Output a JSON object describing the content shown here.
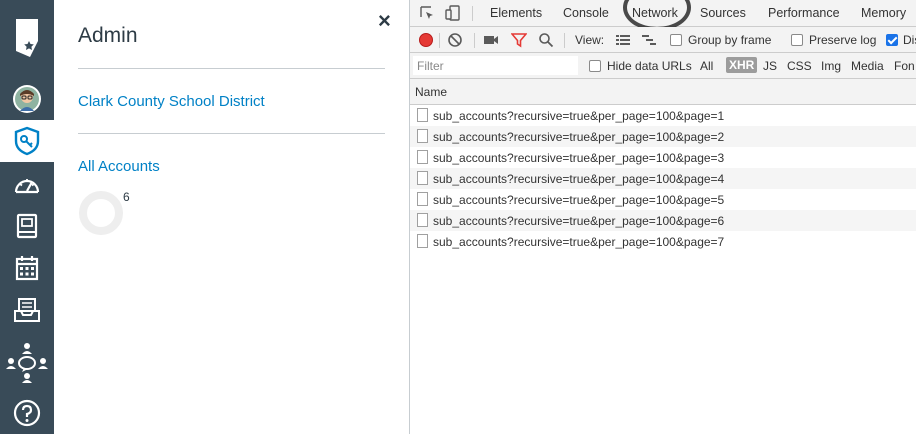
{
  "global_nav": {
    "items": [
      {
        "id": "logo",
        "icon": "nevada-state-logo-icon"
      },
      {
        "id": "account",
        "icon": "user-avatar-icon"
      },
      {
        "id": "admin",
        "icon": "admin-shield-icon",
        "active": true
      },
      {
        "id": "dashboard",
        "icon": "dashboard-speedometer-icon"
      },
      {
        "id": "courses",
        "icon": "courses-book-icon"
      },
      {
        "id": "calendar",
        "icon": "calendar-icon"
      },
      {
        "id": "inbox",
        "icon": "inbox-icon"
      },
      {
        "id": "commons",
        "icon": "commons-people-icon"
      },
      {
        "id": "help",
        "icon": "help-question-icon"
      }
    ],
    "colors": {
      "background": "#394b58",
      "active_background": "#ffffff",
      "active_icon": "#0081c6"
    }
  },
  "admin_tray": {
    "close_label": "×",
    "title": "Admin",
    "links": [
      "Clark County School District",
      "All Accounts"
    ],
    "spinner_count": "6",
    "link_color": "#0081c6"
  },
  "devtools": {
    "tabs": [
      "Elements",
      "Console",
      "Network",
      "Sources",
      "Performance",
      "Memory"
    ],
    "active_tab": "Network",
    "toolbar": {
      "view_label": "View:",
      "group_by_frame": {
        "label": "Group by frame",
        "checked": false
      },
      "preserve_log": {
        "label": "Preserve log",
        "checked": false
      },
      "disable_cache": {
        "label": "Dis",
        "checked": true
      }
    },
    "filter_bar": {
      "placeholder": "Filter",
      "hide_data_urls": {
        "label": "Hide data URLs",
        "checked": false
      },
      "types": [
        "All",
        "XHR",
        "JS",
        "CSS",
        "Img",
        "Media",
        "Fon"
      ],
      "active_type": "XHR"
    },
    "columns": [
      "Name"
    ],
    "requests": [
      "sub_accounts?recursive=true&per_page=100&page=1",
      "sub_accounts?recursive=true&per_page=100&page=2",
      "sub_accounts?recursive=true&per_page=100&page=3",
      "sub_accounts?recursive=true&per_page=100&page=4",
      "sub_accounts?recursive=true&per_page=100&page=5",
      "sub_accounts?recursive=true&per_page=100&page=6",
      "sub_accounts?recursive=true&per_page=100&page=7"
    ]
  }
}
